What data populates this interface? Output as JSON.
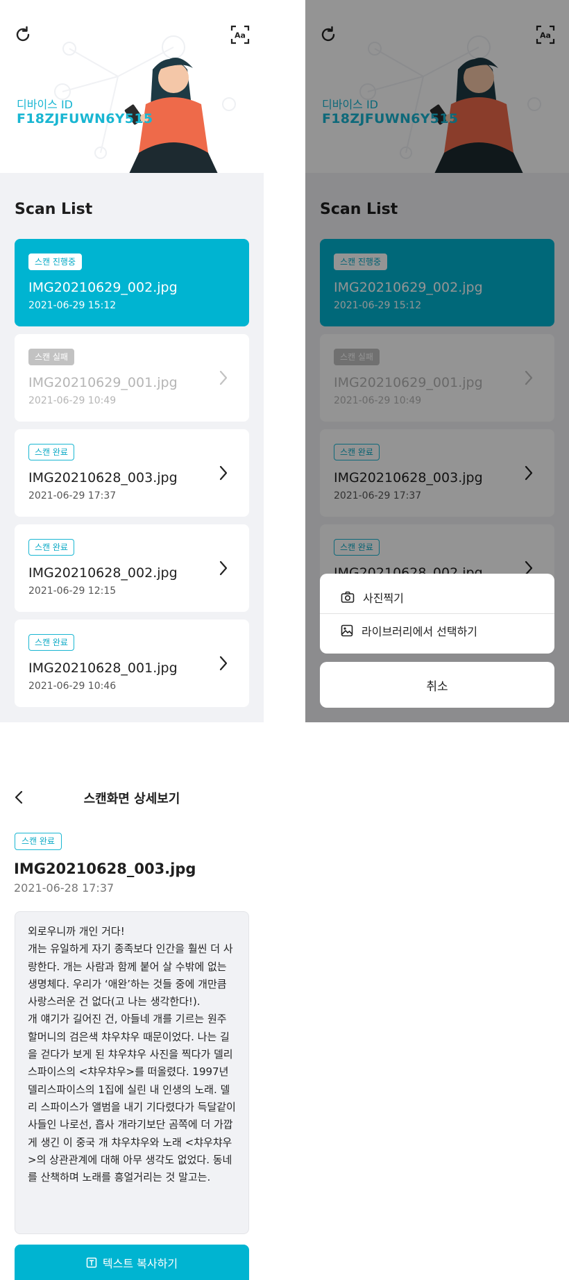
{
  "colors": {
    "accent": "#00b4d1",
    "accent_text": "#19b6d2",
    "failed": "#c2c2c2",
    "background": "#f1f2f5"
  },
  "icons": {
    "refresh": "refresh-icon",
    "font_size": "font-size-icon",
    "chevron": "chevron-right-icon",
    "back": "back-arrow-icon",
    "camera": "camera-icon",
    "image": "image-icon",
    "text": "text-icon"
  },
  "list_screen": {
    "device_label": "디바이스 ID",
    "device_id": "F18ZJFUWN6Y515",
    "section_title": "Scan List",
    "items": [
      {
        "status": "스캔 진행중",
        "state": "in-progress",
        "name": "IMG20210629_002.jpg",
        "date": "2021-06-29  15:12"
      },
      {
        "status": "스캔 실패",
        "state": "failed",
        "name": "IMG20210629_001.jpg",
        "date": "2021-06-29  10:49"
      },
      {
        "status": "스캔 완료",
        "state": "done",
        "name": "IMG20210628_003.jpg",
        "date": "2021-06-29  17:37"
      },
      {
        "status": "스캔 완료",
        "state": "done",
        "name": "IMG20210628_002.jpg",
        "date": "2021-06-29  12:15"
      },
      {
        "status": "스캔 완료",
        "state": "done",
        "name": "IMG20210628_001.jpg",
        "date": "2021-06-29  10:46"
      }
    ]
  },
  "action_sheet": {
    "take_photo": "사진찍기",
    "choose_library": "라이브러리에서 선택하기",
    "cancel": "취소"
  },
  "detail_screen": {
    "title": "스캔화면 상세보기",
    "status": "스캔 완료",
    "name": "IMG20210628_003.jpg",
    "date": "2021-06-28 17:37",
    "body": "외로우니까 개인 거다!\n개는 유일하게 자기 종족보다 인간을 훨씬 더 사랑한다. 개는 사람과 함께 붙어 살 수밖에 없는 생명체다. 우리가 ‘애완’하는 것들 중에 개만큼 사랑스러운 건 없다(고 나는 생각한다!).\n개 얘기가 길어진 건, 아들네 개를 기르는 원주 할머니의 검은색 챠우챠우 때문이었다. 나는 길을 걷다가 보게 된 챠우챠우 사진을 찍다가 델리 스파이스의 <챠우챠우>를 떠올렸다. 1997년 델리스파이스의 1집에 실린 내 인생의 노래. 델리 스파이스가 앨범을 내기 기다렸다가 득달같이 사들인 나로선, 흡사 개라기보단 곰쪽에 더 가깝게 생긴 이 중국 개 챠우챠우와 노래 <챠우챠우>의 상관관계에 대해 아무 생각도 없었다. 동네를 산책하며 노래를 흥얼거리는 것 말고는.",
    "copy_button": "텍스트 복사하기"
  }
}
